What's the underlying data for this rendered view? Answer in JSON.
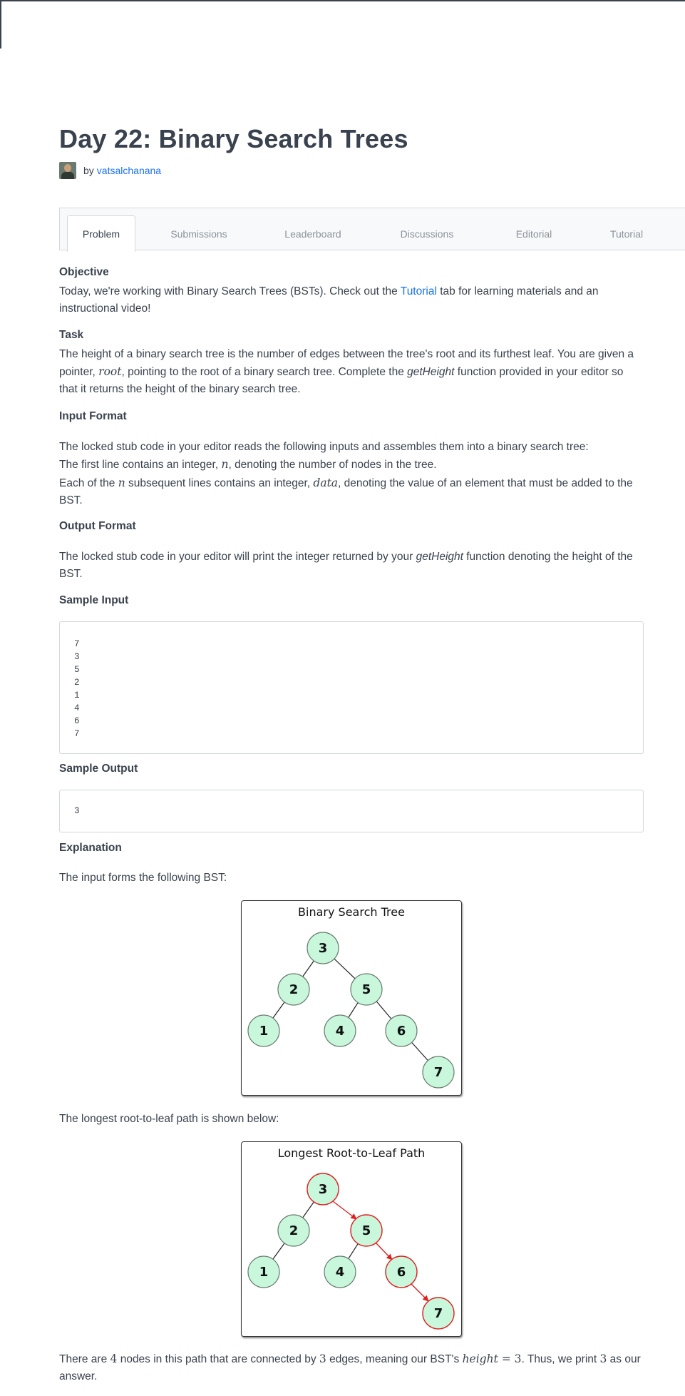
{
  "page": {
    "title": "Day 22: Binary Search Trees",
    "by_label": "by",
    "author": "vatsalchanana"
  },
  "tabs": [
    {
      "label": "Problem",
      "active": true
    },
    {
      "label": "Submissions",
      "active": false
    },
    {
      "label": "Leaderboard",
      "active": false
    },
    {
      "label": "Discussions",
      "active": false
    },
    {
      "label": "Editorial",
      "active": false
    },
    {
      "label": "Tutorial",
      "active": false
    }
  ],
  "objective": {
    "heading": "Objective",
    "text_before": "Today, we're working with Binary Search Trees (BSTs). Check out the ",
    "link": "Tutorial",
    "text_after": " tab for learning materials and an instructional video!"
  },
  "task": {
    "heading": "Task",
    "line1": "The height of a binary search tree is the number of edges between the tree's root and its furthest leaf. You are given a pointer, ",
    "var_root": "root",
    "line2": ", pointing to the root of a binary search tree. Complete the ",
    "fn": "getHeight",
    "line3": " function provided in your editor so that it returns the height of the binary search tree."
  },
  "input_format": {
    "heading": "Input Format",
    "p1": "The locked stub code in your editor reads the following inputs and assembles them into a binary search tree:",
    "p2a": "The first line contains an integer, ",
    "var_n": "n",
    "p2b": ", denoting the number of nodes in the tree.",
    "p3a": "Each of the ",
    "p3b": " subsequent lines contains an integer, ",
    "var_data": "data",
    "p3c": ", denoting the value of an element that must be added to the BST."
  },
  "output_format": {
    "heading": "Output Format",
    "text_a": "The locked stub code in your editor will print the integer returned by your ",
    "fn": "getHeight",
    "text_b": " function denoting the height of the BST."
  },
  "sample_input": {
    "heading": "Sample Input",
    "code": "7\n3\n5\n2\n1\n4\n6\n7"
  },
  "sample_output": {
    "heading": "Sample Output",
    "code": "3"
  },
  "explanation": {
    "heading": "Explanation",
    "p1": "The input forms the following BST:",
    "p2": "The longest root-to-leaf path is shown below:",
    "p3a": "There are ",
    "n4": "4",
    "p3b": " nodes in this path that are connected by ",
    "n3a": "3",
    "p3c": " edges, meaning our BST's ",
    "var_height": "height",
    "eq": " = 3",
    "p3d": ". Thus, we print ",
    "n3b": "3",
    "p3e": " as our answer."
  },
  "figures": {
    "bst": {
      "title": "Binary Search Tree",
      "nodes": [
        "3",
        "2",
        "5",
        "1",
        "4",
        "6",
        "7"
      ]
    },
    "path": {
      "title": "Longest Root-to-Leaf Path",
      "nodes": [
        "3",
        "2",
        "5",
        "1",
        "4",
        "6",
        "7"
      ]
    }
  },
  "colors": {
    "node_fill": "#c8f7dc",
    "node_stroke": "#6a7d70",
    "highlight": "#e02020",
    "link": "#1a73e8"
  }
}
